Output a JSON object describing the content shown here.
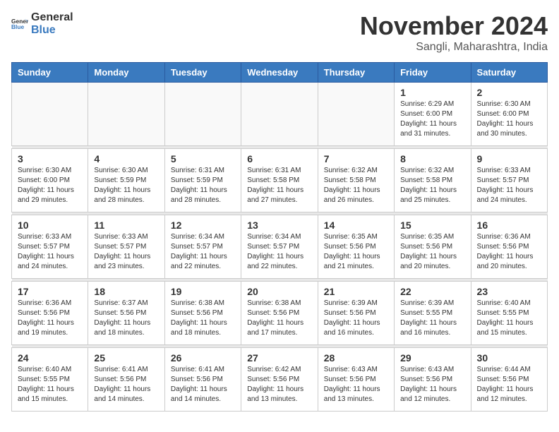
{
  "logo": {
    "general": "General",
    "blue": "Blue"
  },
  "header": {
    "month": "November 2024",
    "location": "Sangli, Maharashtra, India"
  },
  "days": {
    "headers": [
      "Sunday",
      "Monday",
      "Tuesday",
      "Wednesday",
      "Thursday",
      "Friday",
      "Saturday"
    ]
  },
  "weeks": [
    [
      {
        "day": "",
        "info": ""
      },
      {
        "day": "",
        "info": ""
      },
      {
        "day": "",
        "info": ""
      },
      {
        "day": "",
        "info": ""
      },
      {
        "day": "",
        "info": ""
      },
      {
        "day": "1",
        "info": "Sunrise: 6:29 AM\nSunset: 6:00 PM\nDaylight: 11 hours and 31 minutes."
      },
      {
        "day": "2",
        "info": "Sunrise: 6:30 AM\nSunset: 6:00 PM\nDaylight: 11 hours and 30 minutes."
      }
    ],
    [
      {
        "day": "3",
        "info": "Sunrise: 6:30 AM\nSunset: 6:00 PM\nDaylight: 11 hours and 29 minutes."
      },
      {
        "day": "4",
        "info": "Sunrise: 6:30 AM\nSunset: 5:59 PM\nDaylight: 11 hours and 28 minutes."
      },
      {
        "day": "5",
        "info": "Sunrise: 6:31 AM\nSunset: 5:59 PM\nDaylight: 11 hours and 28 minutes."
      },
      {
        "day": "6",
        "info": "Sunrise: 6:31 AM\nSunset: 5:58 PM\nDaylight: 11 hours and 27 minutes."
      },
      {
        "day": "7",
        "info": "Sunrise: 6:32 AM\nSunset: 5:58 PM\nDaylight: 11 hours and 26 minutes."
      },
      {
        "day": "8",
        "info": "Sunrise: 6:32 AM\nSunset: 5:58 PM\nDaylight: 11 hours and 25 minutes."
      },
      {
        "day": "9",
        "info": "Sunrise: 6:33 AM\nSunset: 5:57 PM\nDaylight: 11 hours and 24 minutes."
      }
    ],
    [
      {
        "day": "10",
        "info": "Sunrise: 6:33 AM\nSunset: 5:57 PM\nDaylight: 11 hours and 24 minutes."
      },
      {
        "day": "11",
        "info": "Sunrise: 6:33 AM\nSunset: 5:57 PM\nDaylight: 11 hours and 23 minutes."
      },
      {
        "day": "12",
        "info": "Sunrise: 6:34 AM\nSunset: 5:57 PM\nDaylight: 11 hours and 22 minutes."
      },
      {
        "day": "13",
        "info": "Sunrise: 6:34 AM\nSunset: 5:57 PM\nDaylight: 11 hours and 22 minutes."
      },
      {
        "day": "14",
        "info": "Sunrise: 6:35 AM\nSunset: 5:56 PM\nDaylight: 11 hours and 21 minutes."
      },
      {
        "day": "15",
        "info": "Sunrise: 6:35 AM\nSunset: 5:56 PM\nDaylight: 11 hours and 20 minutes."
      },
      {
        "day": "16",
        "info": "Sunrise: 6:36 AM\nSunset: 5:56 PM\nDaylight: 11 hours and 20 minutes."
      }
    ],
    [
      {
        "day": "17",
        "info": "Sunrise: 6:36 AM\nSunset: 5:56 PM\nDaylight: 11 hours and 19 minutes."
      },
      {
        "day": "18",
        "info": "Sunrise: 6:37 AM\nSunset: 5:56 PM\nDaylight: 11 hours and 18 minutes."
      },
      {
        "day": "19",
        "info": "Sunrise: 6:38 AM\nSunset: 5:56 PM\nDaylight: 11 hours and 18 minutes."
      },
      {
        "day": "20",
        "info": "Sunrise: 6:38 AM\nSunset: 5:56 PM\nDaylight: 11 hours and 17 minutes."
      },
      {
        "day": "21",
        "info": "Sunrise: 6:39 AM\nSunset: 5:56 PM\nDaylight: 11 hours and 16 minutes."
      },
      {
        "day": "22",
        "info": "Sunrise: 6:39 AM\nSunset: 5:55 PM\nDaylight: 11 hours and 16 minutes."
      },
      {
        "day": "23",
        "info": "Sunrise: 6:40 AM\nSunset: 5:55 PM\nDaylight: 11 hours and 15 minutes."
      }
    ],
    [
      {
        "day": "24",
        "info": "Sunrise: 6:40 AM\nSunset: 5:55 PM\nDaylight: 11 hours and 15 minutes."
      },
      {
        "day": "25",
        "info": "Sunrise: 6:41 AM\nSunset: 5:56 PM\nDaylight: 11 hours and 14 minutes."
      },
      {
        "day": "26",
        "info": "Sunrise: 6:41 AM\nSunset: 5:56 PM\nDaylight: 11 hours and 14 minutes."
      },
      {
        "day": "27",
        "info": "Sunrise: 6:42 AM\nSunset: 5:56 PM\nDaylight: 11 hours and 13 minutes."
      },
      {
        "day": "28",
        "info": "Sunrise: 6:43 AM\nSunset: 5:56 PM\nDaylight: 11 hours and 13 minutes."
      },
      {
        "day": "29",
        "info": "Sunrise: 6:43 AM\nSunset: 5:56 PM\nDaylight: 11 hours and 12 minutes."
      },
      {
        "day": "30",
        "info": "Sunrise: 6:44 AM\nSunset: 5:56 PM\nDaylight: 11 hours and 12 minutes."
      }
    ]
  ]
}
